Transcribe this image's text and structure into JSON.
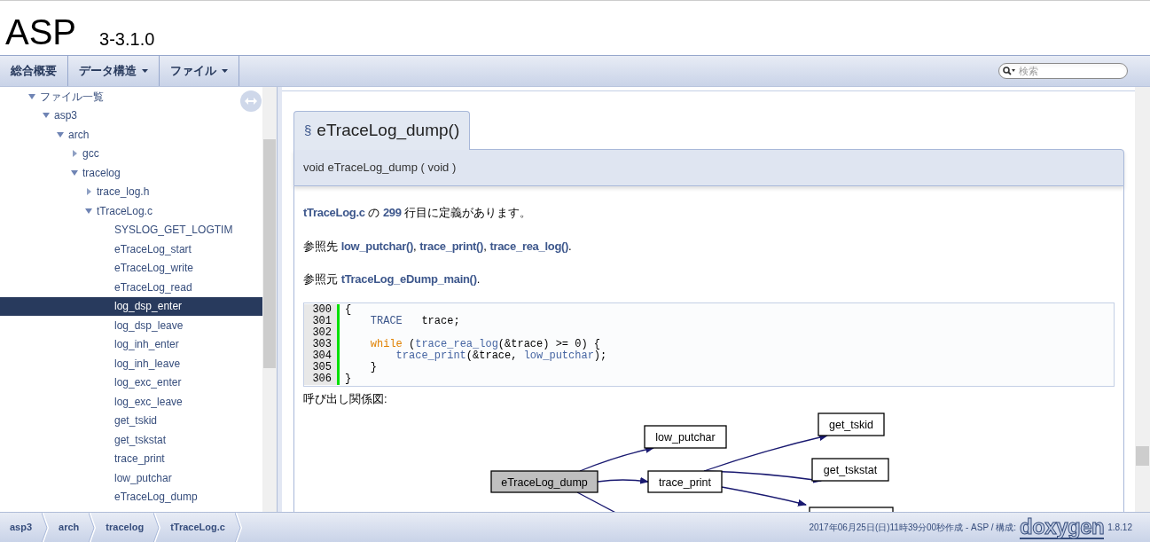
{
  "header": {
    "title": "ASP",
    "version": "3-3.1.0"
  },
  "nav": {
    "tabs": [
      {
        "label": "総合概要",
        "dropdown": false
      },
      {
        "label": "データ構造",
        "dropdown": true
      },
      {
        "label": "ファイル",
        "dropdown": true
      }
    ],
    "search": {
      "placeholder": "検索"
    }
  },
  "tree": [
    {
      "label": "ファイル一覧",
      "kind": "node",
      "expanded": true,
      "selected": false,
      "children": [
        {
          "label": "asp3",
          "kind": "node",
          "expanded": true,
          "selected": false,
          "children": [
            {
              "label": "arch",
              "kind": "node",
              "expanded": true,
              "selected": false,
              "children": [
                {
                  "label": "gcc",
                  "kind": "node",
                  "expanded": false,
                  "selected": false
                },
                {
                  "label": "tracelog",
                  "kind": "node",
                  "expanded": true,
                  "selected": false,
                  "children": [
                    {
                      "label": "trace_log.h",
                      "kind": "node",
                      "expanded": false,
                      "selected": false
                    },
                    {
                      "label": "tTraceLog.c",
                      "kind": "node",
                      "expanded": true,
                      "selected": false,
                      "children": [
                        {
                          "label": "SYSLOG_GET_LOGTIM",
                          "kind": "leaf",
                          "selected": false
                        },
                        {
                          "label": "eTraceLog_start",
                          "kind": "leaf",
                          "selected": false
                        },
                        {
                          "label": "eTraceLog_write",
                          "kind": "leaf",
                          "selected": false
                        },
                        {
                          "label": "eTraceLog_read",
                          "kind": "leaf",
                          "selected": false
                        },
                        {
                          "label": "log_dsp_enter",
                          "kind": "leaf",
                          "selected": true
                        },
                        {
                          "label": "log_dsp_leave",
                          "kind": "leaf",
                          "selected": false
                        },
                        {
                          "label": "log_inh_enter",
                          "kind": "leaf",
                          "selected": false
                        },
                        {
                          "label": "log_inh_leave",
                          "kind": "leaf",
                          "selected": false
                        },
                        {
                          "label": "log_exc_enter",
                          "kind": "leaf",
                          "selected": false
                        },
                        {
                          "label": "log_exc_leave",
                          "kind": "leaf",
                          "selected": false
                        },
                        {
                          "label": "get_tskid",
                          "kind": "leaf",
                          "selected": false
                        },
                        {
                          "label": "get_tskstat",
                          "kind": "leaf",
                          "selected": false
                        },
                        {
                          "label": "trace_print",
                          "kind": "leaf",
                          "selected": false
                        },
                        {
                          "label": "low_putchar",
                          "kind": "leaf",
                          "selected": false
                        },
                        {
                          "label": "eTraceLog_dump",
                          "kind": "leaf",
                          "selected": false
                        }
                      ]
                    }
                  ]
                }
              ]
            }
          ]
        }
      ]
    }
  ],
  "member": {
    "anchor": "§",
    "name": "eTraceLog_dump()",
    "prototype": "void eTraceLog_dump ( void  )",
    "definition": [
      {
        "text": "tTraceLog.c",
        "kind": "link"
      },
      {
        "text": " の ",
        "kind": "text"
      },
      {
        "text": "299",
        "kind": "link"
      },
      {
        "text": " 行目に定義があります。",
        "kind": "text"
      }
    ],
    "references": [
      {
        "text": "参照先 ",
        "kind": "text"
      },
      {
        "text": "low_putchar()",
        "kind": "link"
      },
      {
        "text": ", ",
        "kind": "text"
      },
      {
        "text": "trace_print()",
        "kind": "link"
      },
      {
        "text": ", ",
        "kind": "text"
      },
      {
        "text": "trace_rea_log()",
        "kind": "link"
      },
      {
        "text": ".",
        "kind": "text"
      }
    ],
    "referenced_by": [
      {
        "text": "参照元 ",
        "kind": "text"
      },
      {
        "text": "tTraceLog_eDump_main()",
        "kind": "link"
      },
      {
        "text": ".",
        "kind": "text"
      }
    ],
    "code": [
      {
        "number": "300",
        "tokens": [
          {
            "text": "{",
            "kind": "plain"
          }
        ]
      },
      {
        "number": "301",
        "tokens": [
          {
            "text": "    TRACE",
            "kind": "type"
          },
          {
            "text": "   trace;",
            "kind": "plain"
          }
        ]
      },
      {
        "number": "302"
      },
      {
        "number": "303",
        "tokens": [
          {
            "text": "    while",
            "kind": "keyword"
          },
          {
            "text": " (",
            "kind": "plain"
          },
          {
            "text": "trace_rea_log",
            "kind": "link"
          },
          {
            "text": "(&trace) >= 0) {",
            "kind": "plain"
          }
        ]
      },
      {
        "number": "304",
        "tokens": [
          {
            "text": "        trace_print",
            "kind": "link"
          },
          {
            "text": "(&trace, ",
            "kind": "plain"
          },
          {
            "text": "low_putchar",
            "kind": "link"
          },
          {
            "text": ");",
            "kind": "plain"
          }
        ]
      },
      {
        "number": "305",
        "tokens": [
          {
            "text": "    }",
            "kind": "plain"
          }
        ]
      },
      {
        "number": "306",
        "tokens": [
          {
            "text": "}",
            "kind": "plain"
          }
        ]
      }
    ],
    "graph_title": "呼び出し関係図:",
    "graph": {
      "nodes": [
        {
          "label": "eTraceLog_dump",
          "current": true
        },
        {
          "label": "low_putchar",
          "current": false
        },
        {
          "label": "trace_print",
          "current": false
        },
        {
          "label": "get_tskid",
          "current": false
        },
        {
          "label": "get_tskstat",
          "current": false
        }
      ]
    }
  },
  "footer": {
    "breadcrumbs": [
      "asp3",
      "arch",
      "tracelog",
      "tTraceLog.c"
    ],
    "generated": "2017年06月25日(日)11時39分00秒作成 - ASP / 構成:",
    "logo": "doxygen",
    "doxygen_version": "1.8.12"
  }
}
